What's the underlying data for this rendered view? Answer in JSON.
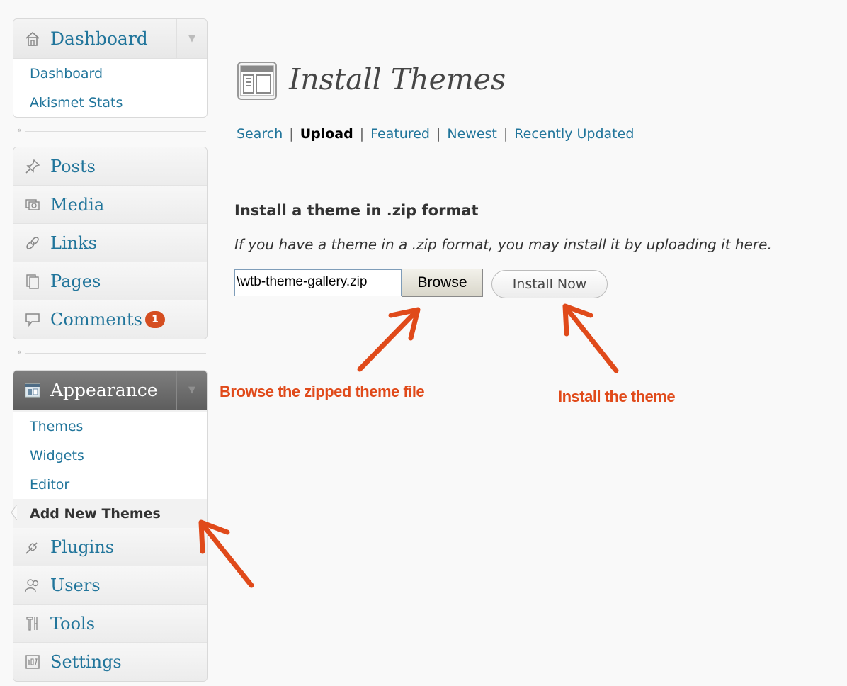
{
  "sidebar": {
    "dashboard": {
      "label": "Dashboard",
      "items": [
        "Dashboard",
        "Akismet Stats"
      ]
    },
    "top_items": [
      {
        "label": "Posts",
        "icon": "pushpin-icon"
      },
      {
        "label": "Media",
        "icon": "media-icon"
      },
      {
        "label": "Links",
        "icon": "link-icon"
      },
      {
        "label": "Pages",
        "icon": "pages-icon"
      },
      {
        "label": "Comments",
        "icon": "comment-icon"
      }
    ],
    "comments_badge": "1",
    "appearance": {
      "label": "Appearance",
      "items": [
        "Themes",
        "Widgets",
        "Editor",
        "Add New Themes"
      ],
      "current": "Add New Themes"
    },
    "bottom_items": [
      {
        "label": "Plugins",
        "icon": "plugin-icon"
      },
      {
        "label": "Users",
        "icon": "users-icon"
      },
      {
        "label": "Tools",
        "icon": "tools-icon"
      },
      {
        "label": "Settings",
        "icon": "settings-icon"
      }
    ]
  },
  "main": {
    "title": "Install Themes",
    "subnav": {
      "search": "Search",
      "upload": "Upload",
      "featured": "Featured",
      "newest": "Newest",
      "recently_updated": "Recently Updated",
      "separator": "|"
    },
    "upload": {
      "heading": "Install a theme in .zip format",
      "description": "If you have a theme in a .zip format, you may install it by uploading it here.",
      "file_value": "\\wtb-theme-gallery.zip",
      "browse_label": "Browse",
      "install_label": "Install Now"
    }
  },
  "annotations": {
    "browse_note": "Browse the zipped theme file",
    "install_note": "Install the theme",
    "color": "#e04a1a"
  },
  "colors": {
    "link": "#21759b",
    "badge": "#d54e21",
    "background": "#f9f9f9"
  }
}
